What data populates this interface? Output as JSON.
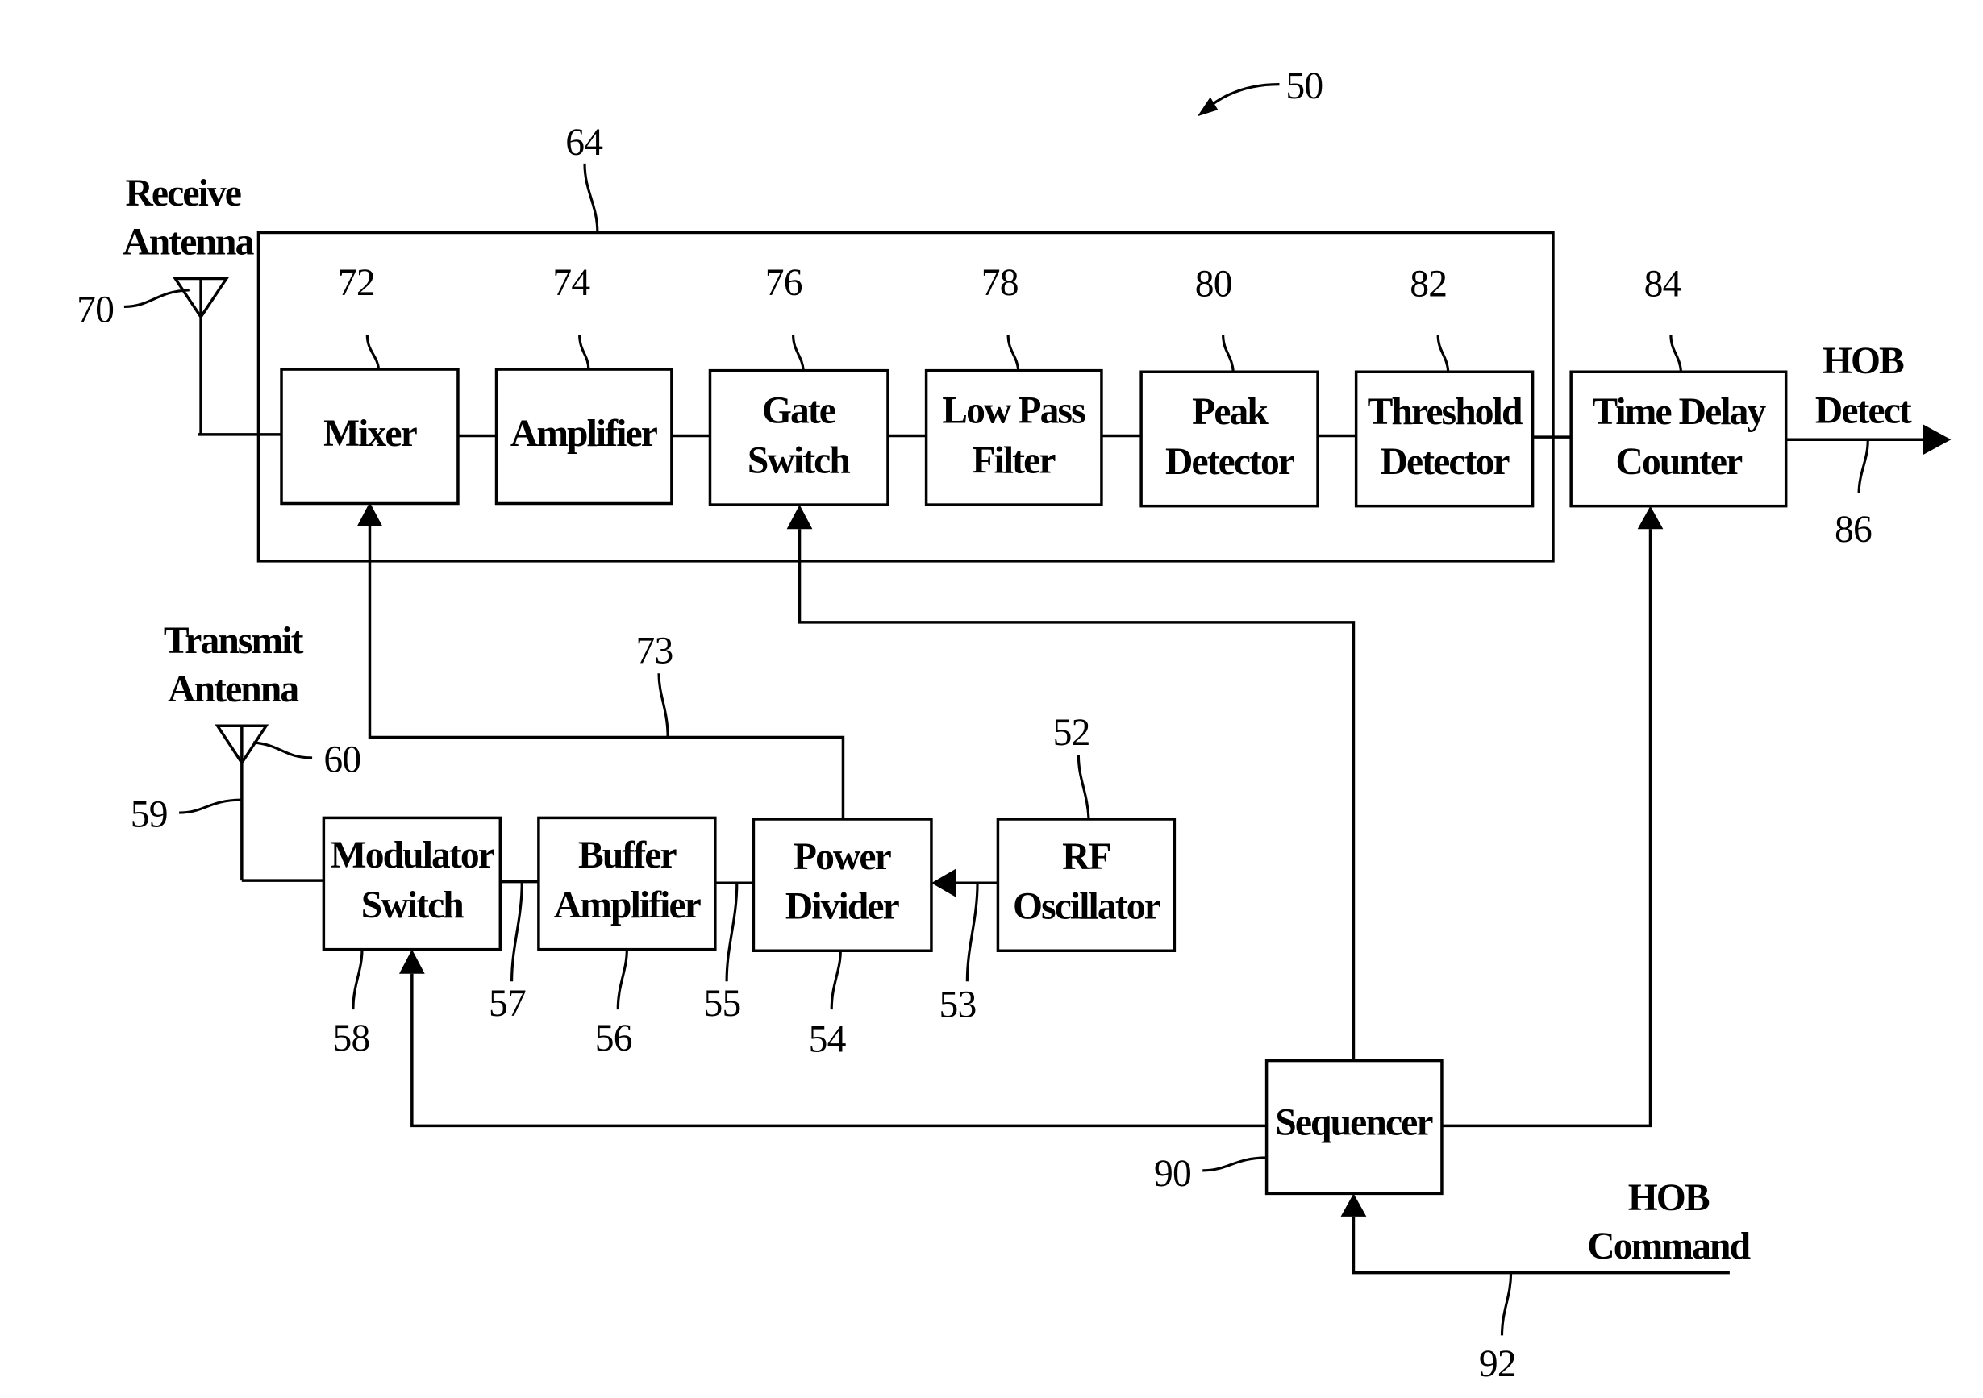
{
  "figure": {
    "reference": "50",
    "receiver_group_ref": "64"
  },
  "antennas": {
    "receive": {
      "label_line1": "Receive",
      "label_line2": "Antenna",
      "ref": "70"
    },
    "transmit": {
      "label_line1": "Transmit",
      "label_line2": "Antenna",
      "ref": "60",
      "feed_ref": "59"
    }
  },
  "receiver_blocks": [
    {
      "ref": "72",
      "line1": "Mixer",
      "line2": ""
    },
    {
      "ref": "74",
      "line1": "Amplifier",
      "line2": ""
    },
    {
      "ref": "76",
      "line1": "Gate",
      "line2": "Switch"
    },
    {
      "ref": "78",
      "line1": "Low Pass",
      "line2": "Filter"
    },
    {
      "ref": "80",
      "line1": "Peak",
      "line2": "Detector"
    },
    {
      "ref": "82",
      "line1": "Threshold",
      "line2": "Detector"
    }
  ],
  "time_delay_counter": {
    "ref": "84",
    "line1": "Time Delay",
    "line2": "Counter"
  },
  "output": {
    "line1": "HOB",
    "line2": "Detect",
    "ref": "86"
  },
  "transmitter_blocks": [
    {
      "ref": "58",
      "line1": "Modulator",
      "line2": "Switch"
    },
    {
      "ref": "56",
      "line1": "Buffer",
      "line2": "Amplifier"
    },
    {
      "ref": "54",
      "line1": "Power",
      "line2": "Divider"
    },
    {
      "ref": "52",
      "line1": "RF",
      "line2": "Oscillator"
    }
  ],
  "connections": {
    "ref_57": "57",
    "ref_55": "55",
    "ref_53": "53",
    "ref_73": "73"
  },
  "sequencer": {
    "ref": "90",
    "label": "Sequencer"
  },
  "command": {
    "line1": "HOB",
    "line2": "Command",
    "ref": "92"
  }
}
